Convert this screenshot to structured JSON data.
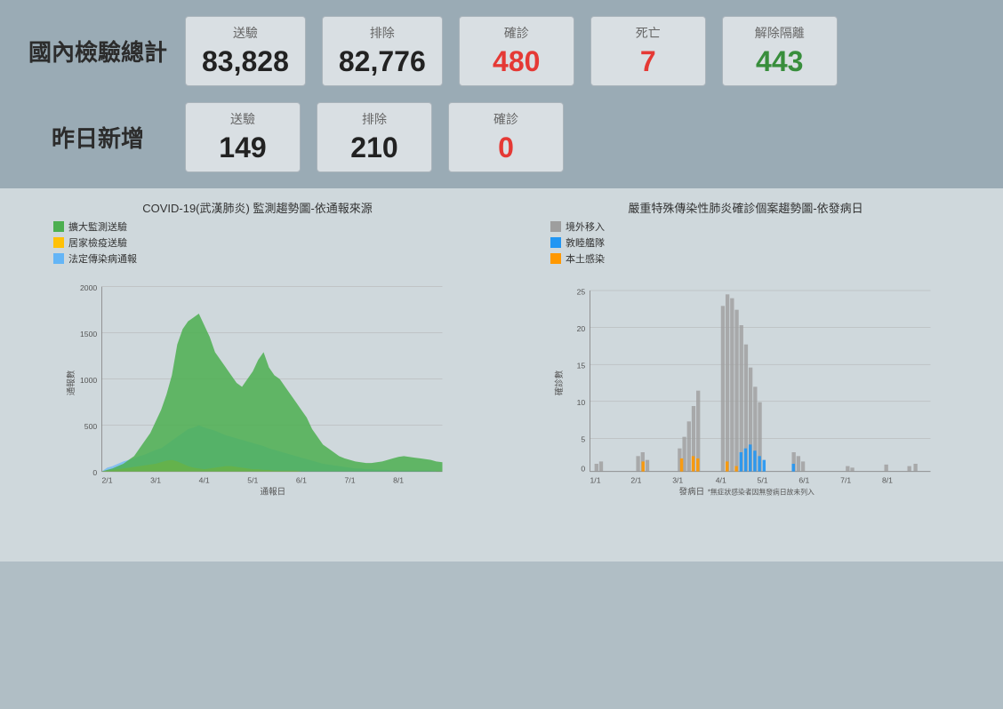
{
  "top": {
    "section1": {
      "label": "國內檢驗總計",
      "cards": [
        {
          "label": "送驗",
          "value": "83,828",
          "color": "normal"
        },
        {
          "label": "排除",
          "value": "82,776",
          "color": "normal"
        },
        {
          "label": "確診",
          "value": "480",
          "color": "red"
        },
        {
          "label": "死亡",
          "value": "7",
          "color": "red"
        },
        {
          "label": "解除隔離",
          "value": "443",
          "color": "green"
        }
      ]
    },
    "section2": {
      "label": "昨日新增",
      "cards": [
        {
          "label": "送驗",
          "value": "149",
          "color": "normal"
        },
        {
          "label": "排除",
          "value": "210",
          "color": "normal"
        },
        {
          "label": "確診",
          "value": "0",
          "color": "red"
        }
      ]
    }
  },
  "charts": {
    "left": {
      "title": "COVID-19(武漢肺炎) 監測趨勢圖-依通報來源",
      "y_label": "通報數",
      "x_label": "通報日",
      "legend": [
        {
          "color": "#4caf50",
          "label": "擴大監測送驗"
        },
        {
          "color": "#ffc107",
          "label": "居家檢疫送驗"
        },
        {
          "color": "#64b5f6",
          "label": "法定傳染病通報"
        }
      ],
      "y_ticks": [
        "2000",
        "1500",
        "1000",
        "500",
        "0"
      ],
      "x_ticks": [
        "2/1",
        "3/1",
        "4/1",
        "5/1",
        "6/1",
        "7/1",
        "8/1"
      ]
    },
    "right": {
      "title": "嚴重特殊傳染性肺炎確診個案趨勢圖-依發病日",
      "y_label": "確診數",
      "x_label": "發病日",
      "footnote": "*無症狀感染者因無發病日故未列入",
      "legend": [
        {
          "color": "#9e9e9e",
          "label": "境外移入"
        },
        {
          "color": "#2196f3",
          "label": "敦睦艦隊"
        },
        {
          "color": "#ff9800",
          "label": "本土感染"
        }
      ],
      "y_ticks": [
        "25",
        "20",
        "15",
        "10",
        "5",
        "0"
      ],
      "x_ticks": [
        "1/1",
        "2/1",
        "3/1",
        "4/1",
        "5/1",
        "6/1",
        "7/1",
        "8/1"
      ]
    }
  }
}
